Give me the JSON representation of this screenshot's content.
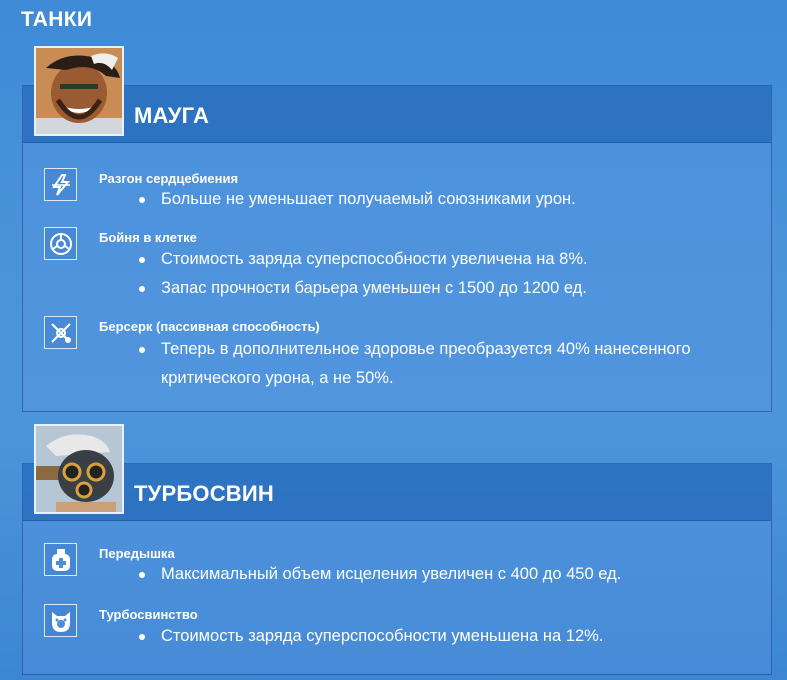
{
  "section": {
    "title": "ТАНКИ"
  },
  "heroes": [
    {
      "name": "МАУГА",
      "abilities": [
        {
          "name": "Разгон сердцебиения",
          "icon": "heartbeat-icon",
          "changes": [
            "Больше не уменьшает получаемый союзниками урон."
          ]
        },
        {
          "name": "Бойня в клетке",
          "icon": "cage-fight-icon",
          "changes": [
            "Стоимость заряда суперспособности увеличена на 8%.",
            "Запас прочности барьера уменьшен с 1500 до 1200 ед."
          ]
        },
        {
          "name": "Берсерк (пассивная способность)",
          "icon": "berserker-icon",
          "changes": [
            "Теперь в дополнительное здоровье преобразуется 40% нанесенного критического урона, а не 50%."
          ]
        }
      ]
    },
    {
      "name": "ТУРБОСВИН",
      "abilities": [
        {
          "name": "Передышка",
          "icon": "take-a-breather-icon",
          "changes": [
            "Максимальный объем исцеления увеличен с 400 до 450 ед."
          ]
        },
        {
          "name": "Турбосвинство",
          "icon": "whole-hog-icon",
          "changes": [
            "Стоимость заряда суперспособности уменьшена на 12%."
          ]
        }
      ]
    }
  ],
  "colors": {
    "background": "#4a93db",
    "header": "#2f6fb8",
    "text": "#ffffff"
  }
}
